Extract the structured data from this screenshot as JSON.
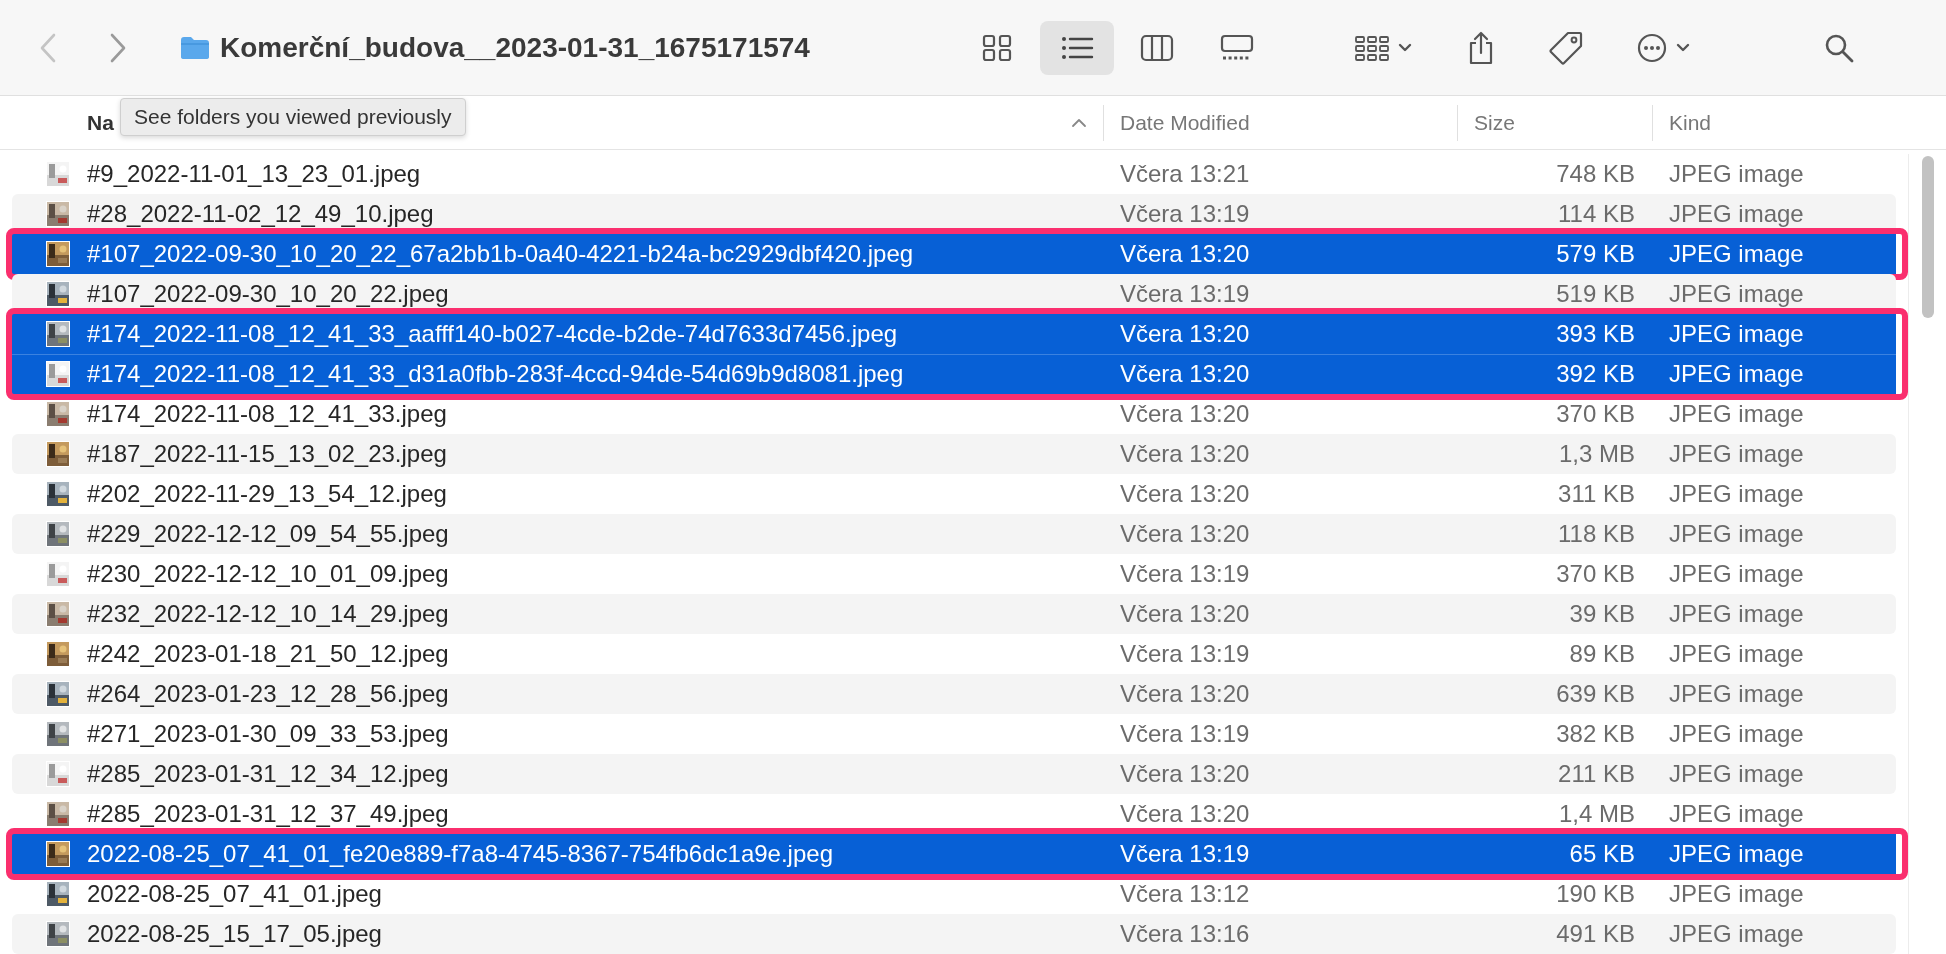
{
  "toolbar": {
    "title": "Komerční_budova__2023-01-31_1675171574",
    "view_modes": [
      {
        "kind": "icons",
        "selected": false
      },
      {
        "kind": "list",
        "selected": true
      },
      {
        "kind": "columns",
        "selected": false
      },
      {
        "kind": "gallery",
        "selected": false
      }
    ]
  },
  "tooltip": "See folders you viewed previously",
  "columns": [
    {
      "label": "Na"
    },
    {
      "label": "Date Modified"
    },
    {
      "label": "Size"
    },
    {
      "label": "Kind"
    }
  ],
  "rows": [
    {
      "name": "#9_2022-11-01_13_23_01.jpeg",
      "date": "Včera 13:21",
      "size": "748 KB",
      "kind": "JPEG image",
      "selected": false
    },
    {
      "name": "#28_2022-11-02_12_49_10.jpeg",
      "date": "Včera 13:19",
      "size": "114 KB",
      "kind": "JPEG image",
      "selected": false
    },
    {
      "name": "#107_2022-09-30_10_20_22_67a2bb1b-0a40-4221-b24a-bc2929dbf420.jpeg",
      "date": "Včera 13:20",
      "size": "579 KB",
      "kind": "JPEG image",
      "selected": true
    },
    {
      "name": "#107_2022-09-30_10_20_22.jpeg",
      "date": "Včera 13:19",
      "size": "519 KB",
      "kind": "JPEG image",
      "selected": false
    },
    {
      "name": "#174_2022-11-08_12_41_33_aafff140-b027-4cde-b2de-74d7633d7456.jpeg",
      "date": "Včera 13:20",
      "size": "393 KB",
      "kind": "JPEG image",
      "selected": true
    },
    {
      "name": "#174_2022-11-08_12_41_33_d31a0fbb-283f-4ccd-94de-54d69b9d8081.jpeg",
      "date": "Včera 13:20",
      "size": "392 KB",
      "kind": "JPEG image",
      "selected": true
    },
    {
      "name": "#174_2022-11-08_12_41_33.jpeg",
      "date": "Včera 13:20",
      "size": "370 KB",
      "kind": "JPEG image",
      "selected": false
    },
    {
      "name": "#187_2022-11-15_13_02_23.jpeg",
      "date": "Včera 13:20",
      "size": "1,3 MB",
      "kind": "JPEG image",
      "selected": false
    },
    {
      "name": "#202_2022-11-29_13_54_12.jpeg",
      "date": "Včera 13:20",
      "size": "311 KB",
      "kind": "JPEG image",
      "selected": false
    },
    {
      "name": "#229_2022-12-12_09_54_55.jpeg",
      "date": "Včera 13:20",
      "size": "118 KB",
      "kind": "JPEG image",
      "selected": false
    },
    {
      "name": "#230_2022-12-12_10_01_09.jpeg",
      "date": "Včera 13:19",
      "size": "370 KB",
      "kind": "JPEG image",
      "selected": false
    },
    {
      "name": "#232_2022-12-12_10_14_29.jpeg",
      "date": "Včera 13:20",
      "size": "39 KB",
      "kind": "JPEG image",
      "selected": false
    },
    {
      "name": "#242_2023-01-18_21_50_12.jpeg",
      "date": "Včera 13:19",
      "size": "89 KB",
      "kind": "JPEG image",
      "selected": false
    },
    {
      "name": "#264_2023-01-23_12_28_56.jpeg",
      "date": "Včera 13:20",
      "size": "639 KB",
      "kind": "JPEG image",
      "selected": false
    },
    {
      "name": "#271_2023-01-30_09_33_53.jpeg",
      "date": "Včera 13:19",
      "size": "382 KB",
      "kind": "JPEG image",
      "selected": false
    },
    {
      "name": "#285_2023-01-31_12_34_12.jpeg",
      "date": "Včera 13:20",
      "size": "211 KB",
      "kind": "JPEG image",
      "selected": false
    },
    {
      "name": "#285_2023-01-31_12_37_49.jpeg",
      "date": "Včera 13:20",
      "size": "1,4 MB",
      "kind": "JPEG image",
      "selected": false
    },
    {
      "name": "2022-08-25_07_41_01_fe20e889-f7a8-4745-8367-754fb6dc1a9e.jpeg",
      "date": "Včera 13:19",
      "size": "65 KB",
      "kind": "JPEG image",
      "selected": true
    },
    {
      "name": "2022-08-25_07_41_01.jpeg",
      "date": "Včera 13:12",
      "size": "190 KB",
      "kind": "JPEG image",
      "selected": false
    },
    {
      "name": "2022-08-25_15_17_05.jpeg",
      "date": "Včera 13:16",
      "size": "491 KB",
      "kind": "JPEG image",
      "selected": false
    }
  ]
}
